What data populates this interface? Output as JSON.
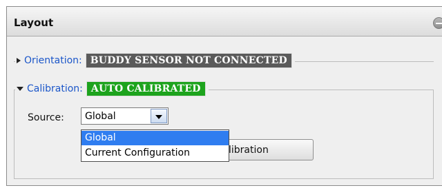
{
  "panel": {
    "title": "Layout"
  },
  "orientation": {
    "label": "Orientation:",
    "status": "BUDDY SENSOR NOT CONNECTED"
  },
  "calibration": {
    "label": "Calibration:",
    "status": "AUTO CALIBRATED"
  },
  "source": {
    "label": "Source:",
    "selected": "Global",
    "options": [
      "Global",
      "Current Configuration"
    ]
  },
  "calibration_button": {
    "visible_label": "libration"
  },
  "colors": {
    "link": "#1b56c9",
    "badge_not_connected": "#5a5a5a",
    "badge_auto_calibrated": "#1da31d",
    "dropdown_highlight": "#2f7df0"
  }
}
